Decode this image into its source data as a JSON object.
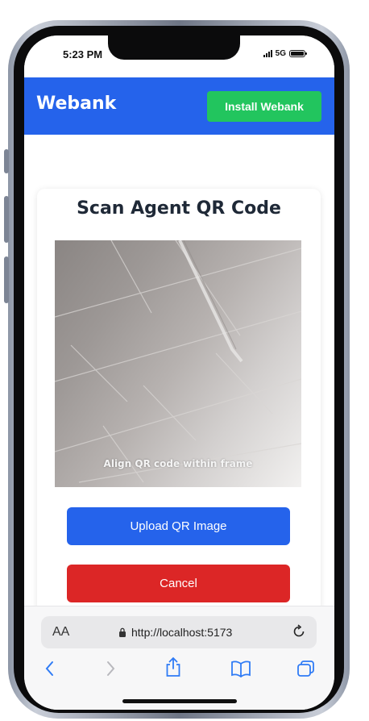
{
  "status_bar": {
    "time": "5:23 PM",
    "network": "5G",
    "icons": [
      "signal-icon",
      "battery-icon"
    ]
  },
  "header": {
    "brand": "Webank",
    "install_label": "Install Webank"
  },
  "scanner": {
    "title": "Scan Agent QR Code",
    "hint": "Align QR code within frame",
    "upload_label": "Upload QR Image",
    "cancel_label": "Cancel"
  },
  "browser": {
    "text_size_label": "AA",
    "url": "http://localhost:5173",
    "icons": [
      "lock-icon",
      "reload-icon",
      "back-icon",
      "forward-icon",
      "share-icon",
      "bookmarks-icon",
      "tabs-icon"
    ]
  },
  "colors": {
    "primary": "#2563eb",
    "install": "#22c55e",
    "cancel": "#dc2626"
  }
}
